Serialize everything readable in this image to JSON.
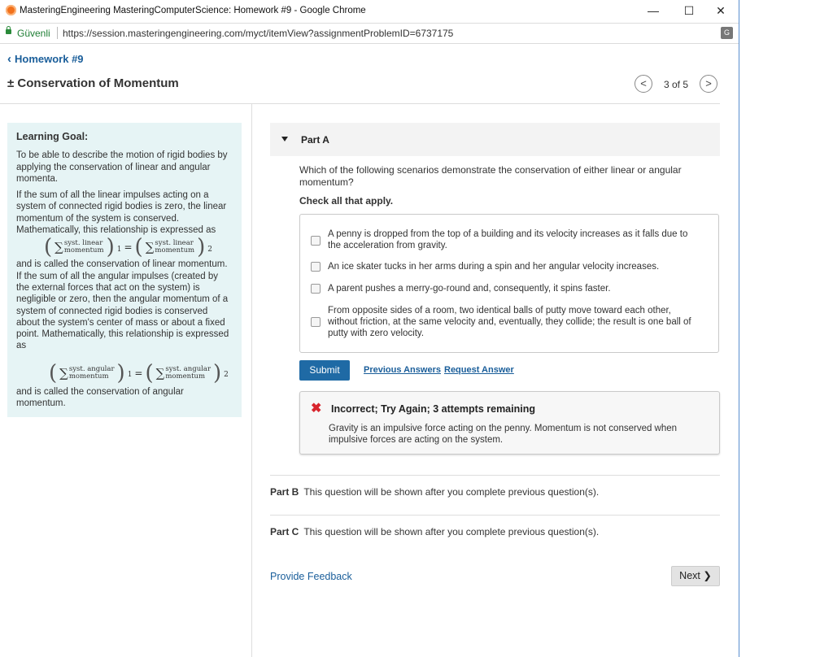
{
  "browser": {
    "window_title": "MasteringEngineering MasteringComputerScience: Homework #9 - Google Chrome",
    "secure_label": "Güvenli",
    "url": "https://session.masteringengineering.com/myct/itemView?assignmentProblemID=6737175",
    "minimize": "—",
    "maximize": "☐",
    "close": "✕"
  },
  "header": {
    "breadcrumb": "Homework #9",
    "title": "± Conservation of Momentum",
    "page_counter": "3 of 5",
    "prev": "<",
    "next": ">"
  },
  "goal": {
    "heading": "Learning Goal:",
    "p1": "To be able to describe the motion of rigid bodies by applying the conservation of linear and angular momenta.",
    "p2": "If the sum of all the linear impulses acting on a system of connected rigid bodies is zero, the linear momentum of the system is conserved. Mathematically, this relationship is expressed as",
    "eq1": {
      "top": "syst. linear",
      "bottom": "momentum",
      "sub1": "1",
      "sub2": "2"
    },
    "p3": "and is called the conservation of linear momentum. If the sum of all the angular impulses (created by the external forces that act on the system) is negligible or zero, then the angular momentum of a system of connected rigid bodies is conserved about the system's center of mass or about a fixed point. Mathematically, this relationship is expressed as",
    "eq2": {
      "top": "syst. angular",
      "bottom": "momentum",
      "sub1": "1",
      "sub2": "2"
    },
    "p4": "and is called the conservation of angular momentum."
  },
  "partA": {
    "label": "Part A",
    "question": "Which of the following scenarios demonstrate the conservation of either linear or angular momentum?",
    "instruction": "Check all that apply.",
    "options": [
      "A penny is dropped from the top of a building and its velocity increases as it falls due to the acceleration from gravity.",
      "An ice skater tucks in her arms during a spin and her angular velocity increases.",
      "A parent pushes a merry-go-round and, consequently, it spins faster.",
      "From opposite sides of a room, two identical balls of putty move toward each other, without friction, at the same velocity and, eventually, they collide; the result is one ball of putty with zero velocity."
    ],
    "submit": "Submit",
    "previous_answers": "Previous Answers",
    "request_answer": "Request Answer",
    "feedback_title": "Incorrect; Try Again; 3 attempts remaining",
    "feedback_text": "Gravity is an impulsive force acting on the penny. Momentum is not conserved when impulsive forces are acting on the system."
  },
  "partB": {
    "label": "Part B",
    "text": "This question will be shown after you complete previous question(s)."
  },
  "partC": {
    "label": "Part C",
    "text": "This question will be shown after you complete previous question(s)."
  },
  "footer": {
    "provide_feedback": "Provide Feedback",
    "next": "Next ❯"
  }
}
